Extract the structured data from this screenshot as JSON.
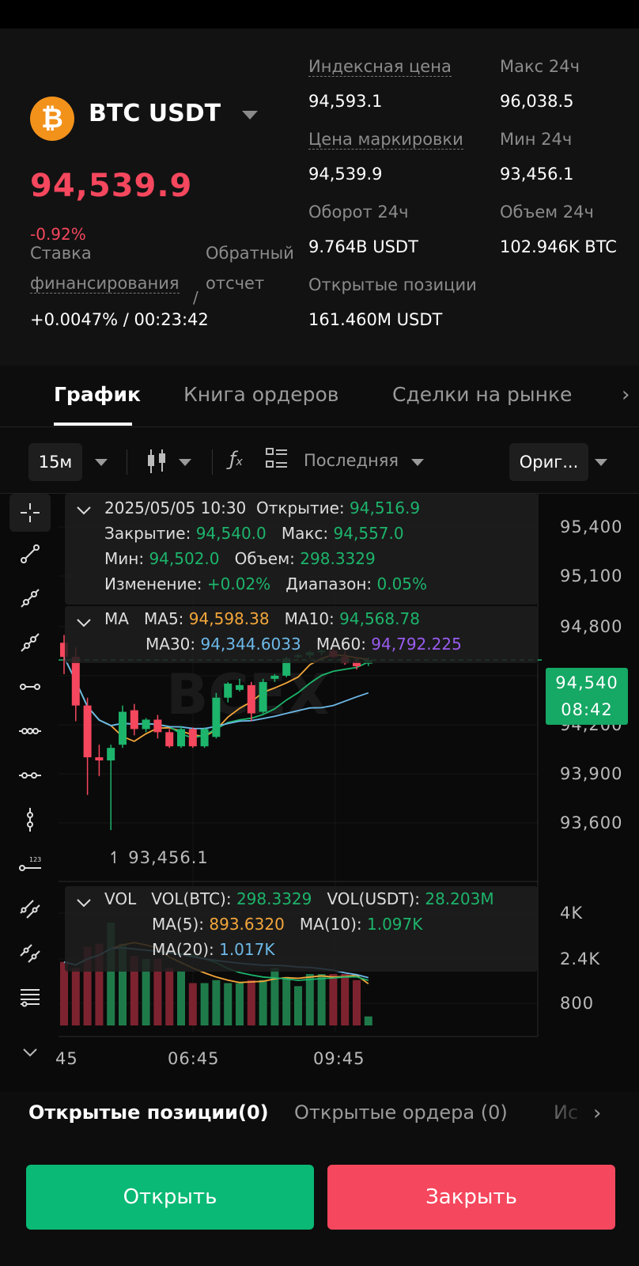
{
  "header": {
    "coin_symbol": "₿",
    "pair": "BTC USDT",
    "last_price": "94,539.9",
    "change": "-0.92%",
    "funding_label": "Ставка финансирования",
    "funding_line1": "Ставка",
    "funding_line2": "финансирования",
    "countdown_label_line1": "Обратный",
    "countdown_label_line2": "отсчет",
    "funding_value": "+0.0047%  /  00:23:42",
    "stats": {
      "index_label": "Индексная цена",
      "index_value": "94,593.1",
      "mark_label": "Цена маркировки",
      "mark_value": "94,539.9",
      "turnover_label": "Оборот 24ч",
      "turnover_value": "9.764B USDT",
      "oi_label": "Открытые позиции",
      "oi_value": "161.460M USDT",
      "high_label": "Макс 24ч",
      "high_value": "96,038.5",
      "low_label": "Мин 24ч",
      "low_value": "93,456.1",
      "volume_label": "Объем 24ч",
      "volume_value": "102.946K BTC"
    }
  },
  "tabs": [
    "График",
    "Книга ордеров",
    "Сделки на рынке"
  ],
  "toolbar": {
    "timeframe": "15м",
    "last_label": "Последняя",
    "source_btn": "Ориг..."
  },
  "ohlc": {
    "datetime": "2025/05/05 10:30",
    "open_label": "Открытие:",
    "open": "94,516.9",
    "close_label": "Закрытие:",
    "close": "94,540.0",
    "high_label": "Макс:",
    "high": "94,557.0",
    "low_label": "Мин:",
    "low": "94,502.0",
    "volume_label": "Объем:",
    "volume": "298.3329",
    "change_label": "Изменение:",
    "change": "+0.02%",
    "range_label": "Диапазон:",
    "range": "0.05%"
  },
  "ma": {
    "title": "MA",
    "ma5_label": "MA5:",
    "ma5": "94,598.38",
    "ma10_label": "MA10:",
    "ma10": "94,568.78",
    "ma30_label": "MA30:",
    "ma30": "94,344.6033",
    "ma60_label": "MA60:",
    "ma60": "94,792.225"
  },
  "vol": {
    "title": "VOL",
    "btc_label": "VOL(BTC):",
    "btc": "298.3329",
    "usdt_label": "VOL(USDT):",
    "usdt": "28.203M",
    "ma5_label": "MA(5):",
    "ma5": "893.6320",
    "ma10_label": "MA(10):",
    "ma10": "1.097K",
    "ma20_label": "MA(20):",
    "ma20": "1.017K"
  },
  "price_axis": [
    "95,400",
    "95,100",
    "94,800",
    "94,200",
    "93,900",
    "93,600"
  ],
  "price_tag": {
    "price": "94,540",
    "countdown": "08:42"
  },
  "low_marker": "93,456.1",
  "vol_axis": [
    "4K",
    "2.4K",
    "800"
  ],
  "time_axis": [
    "45",
    "06:45",
    "09:45"
  ],
  "bottom_tabs": [
    "Открытые позиции(0)",
    "Открытые ордера (0)",
    "Ис"
  ],
  "actions": {
    "open": "Открыть",
    "close": "Закрыть"
  },
  "colors": {
    "up": "#1db46b",
    "down": "#f5475d",
    "ma5": "#f3a63a",
    "ma10": "#1db46b",
    "ma30": "#6db9e8",
    "ma60": "#9a5cf0"
  },
  "chart_data": {
    "type": "candlestick",
    "interval": "15м",
    "candles": [
      {
        "o": 94650,
        "h": 94700,
        "c": 94560,
        "l": 94450
      },
      {
        "o": 94560,
        "h": 94620,
        "c": 94250,
        "l": 94150
      },
      {
        "o": 94250,
        "h": 94300,
        "c": 93920,
        "l": 93680
      },
      {
        "o": 93920,
        "h": 94000,
        "c": 93900,
        "l": 93800
      },
      {
        "o": 93900,
        "h": 94000,
        "c": 93980,
        "l": 93456.1
      },
      {
        "o": 94000,
        "h": 94250,
        "c": 94210,
        "l": 93980
      },
      {
        "o": 94220,
        "h": 94260,
        "c": 94100,
        "l": 94060
      },
      {
        "o": 94100,
        "h": 94170,
        "c": 94160,
        "l": 94080
      },
      {
        "o": 94160,
        "h": 94190,
        "c": 94080,
        "l": 94040
      },
      {
        "o": 94080,
        "h": 94100,
        "c": 93990,
        "l": 93980
      },
      {
        "o": 93990,
        "h": 94120,
        "c": 94100,
        "l": 93980
      },
      {
        "o": 94100,
        "h": 94110,
        "c": 93990,
        "l": 93980
      },
      {
        "o": 93990,
        "h": 94110,
        "c": 94100,
        "l": 93980
      },
      {
        "o": 94050,
        "h": 94330,
        "c": 94300,
        "l": 94040
      },
      {
        "o": 94300,
        "h": 94400,
        "c": 94390,
        "l": 94270
      },
      {
        "o": 94350,
        "h": 94420,
        "c": 94380,
        "l": 94340
      },
      {
        "o": 94380,
        "h": 94400,
        "c": 94200,
        "l": 94150
      },
      {
        "o": 94210,
        "h": 94420,
        "c": 94400,
        "l": 94200
      },
      {
        "o": 94420,
        "h": 94450,
        "c": 94440,
        "l": 94400
      },
      {
        "o": 94440,
        "h": 94560,
        "c": 94550,
        "l": 94430
      },
      {
        "o": 94560,
        "h": 94580,
        "c": 94570,
        "l": 94550
      },
      {
        "o": 94570,
        "h": 94600,
        "c": 94590,
        "l": 94550
      },
      {
        "o": 94590,
        "h": 94610,
        "c": 94600,
        "l": 94570
      },
      {
        "o": 94600,
        "h": 94620,
        "c": 94560,
        "l": 94550
      },
      {
        "o": 94560,
        "h": 94600,
        "c": 94520,
        "l": 94510
      },
      {
        "o": 94530,
        "h": 94560,
        "c": 94500,
        "l": 94480
      },
      {
        "o": 94516.9,
        "h": 94557.0,
        "c": 94540.0,
        "l": 94502.0
      }
    ],
    "volume": [
      2100,
      1900,
      2600,
      2700,
      3400,
      2700,
      2300,
      2200,
      2200,
      1900,
      1800,
      1400,
      1400,
      1500,
      1400,
      1400,
      1500,
      1500,
      1900,
      1600,
      1300,
      1700,
      1700,
      1700,
      1700,
      1500,
      298.3329
    ],
    "ylim": [
      93300,
      95600
    ],
    "vol_ylim": [
      0,
      4500
    ]
  }
}
